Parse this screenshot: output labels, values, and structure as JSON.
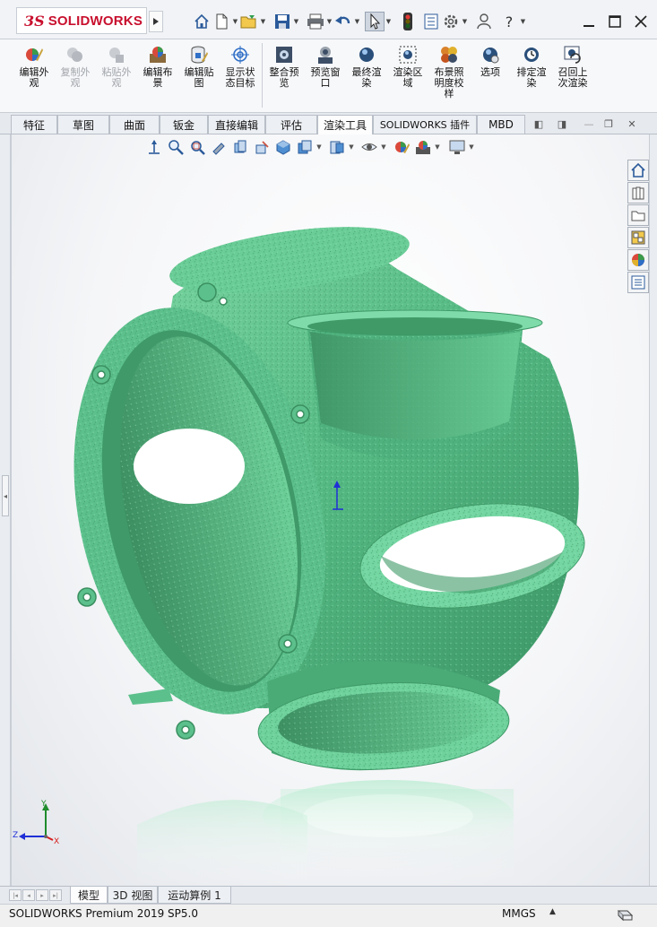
{
  "app": {
    "logo_ds": "3S",
    "logo_name": "SOLIDWORKS"
  },
  "quick_access": {
    "icons": [
      "home-icon",
      "new-document-icon",
      "open-file-icon",
      "save-icon",
      "print-icon",
      "undo-icon",
      "select-pointer-icon",
      "rebuild-traffic-light-icon",
      "file-properties-icon",
      "options-gear-icon",
      "user-icon",
      "help-icon",
      "minimize-icon",
      "maximize-icon",
      "close-icon"
    ]
  },
  "command_manager": {
    "commands": [
      {
        "label": "编辑外\n观",
        "enabled": true,
        "icon": "edit-appearance-icon"
      },
      {
        "label": "复制外\n观",
        "enabled": false,
        "icon": "copy-appearance-icon"
      },
      {
        "label": "粘贴外\n观",
        "enabled": false,
        "icon": "paste-appearance-icon"
      },
      {
        "label": "编辑布\n景",
        "enabled": true,
        "icon": "edit-scene-icon"
      },
      {
        "label": "编辑贴\n图",
        "enabled": true,
        "icon": "edit-decal-icon"
      },
      {
        "label": "显示状\n态目标",
        "enabled": true,
        "icon": "display-state-target-icon"
      },
      {
        "label": "整合预\n览",
        "enabled": true,
        "icon": "integrated-preview-icon"
      },
      {
        "label": "预览窗\n口",
        "enabled": true,
        "icon": "preview-window-icon"
      },
      {
        "label": "最终渲\n染",
        "enabled": true,
        "icon": "final-render-icon"
      },
      {
        "label": "渲染区\n域",
        "enabled": true,
        "icon": "render-region-icon"
      },
      {
        "label": "布景照\n明度校\n样",
        "enabled": true,
        "icon": "scene-illumination-proof-icon"
      },
      {
        "label": "选项",
        "enabled": true,
        "icon": "options-icon"
      },
      {
        "label": "排定渲\n染",
        "enabled": true,
        "icon": "schedule-render-icon"
      },
      {
        "label": "召回上\n次渲染",
        "enabled": true,
        "icon": "recall-last-render-icon"
      }
    ]
  },
  "tabs": {
    "items": [
      "特征",
      "草图",
      "曲面",
      "钣金",
      "直接编辑",
      "评估",
      "渲染工具",
      "SOLIDWORKS 插件",
      "MBD"
    ],
    "active": "渲染工具"
  },
  "heads_up_toolbar": {
    "icons": [
      "view-orientation-icon",
      "zoom-to-fit-icon",
      "zoom-to-area-icon",
      "previous-view-icon",
      "section-view-icon",
      "dynamic-annotation-icon",
      "view-orientation-cube-icon",
      "display-style-icon",
      "hide-show-items-icon",
      "edit-appearance-icon",
      "apply-scene-icon",
      "view-settings-icon"
    ]
  },
  "task_pane": {
    "icons": [
      "solidworks-resources-icon",
      "design-library-icon",
      "file-explorer-icon",
      "view-palette-icon",
      "appearances-scenes-icon",
      "custom-properties-icon"
    ]
  },
  "triad": {
    "x": "X",
    "y": "Y",
    "z": "Z"
  },
  "bottom_tabs": {
    "items": [
      "模型",
      "3D 视图",
      "运动算例 1"
    ],
    "active": "模型"
  },
  "status": {
    "product": "SOLIDWORKS Premium 2019 SP5.0",
    "units": "MMGS"
  },
  "colors": {
    "model_green": "#5fc48c",
    "logo_red": "#c8102e"
  }
}
